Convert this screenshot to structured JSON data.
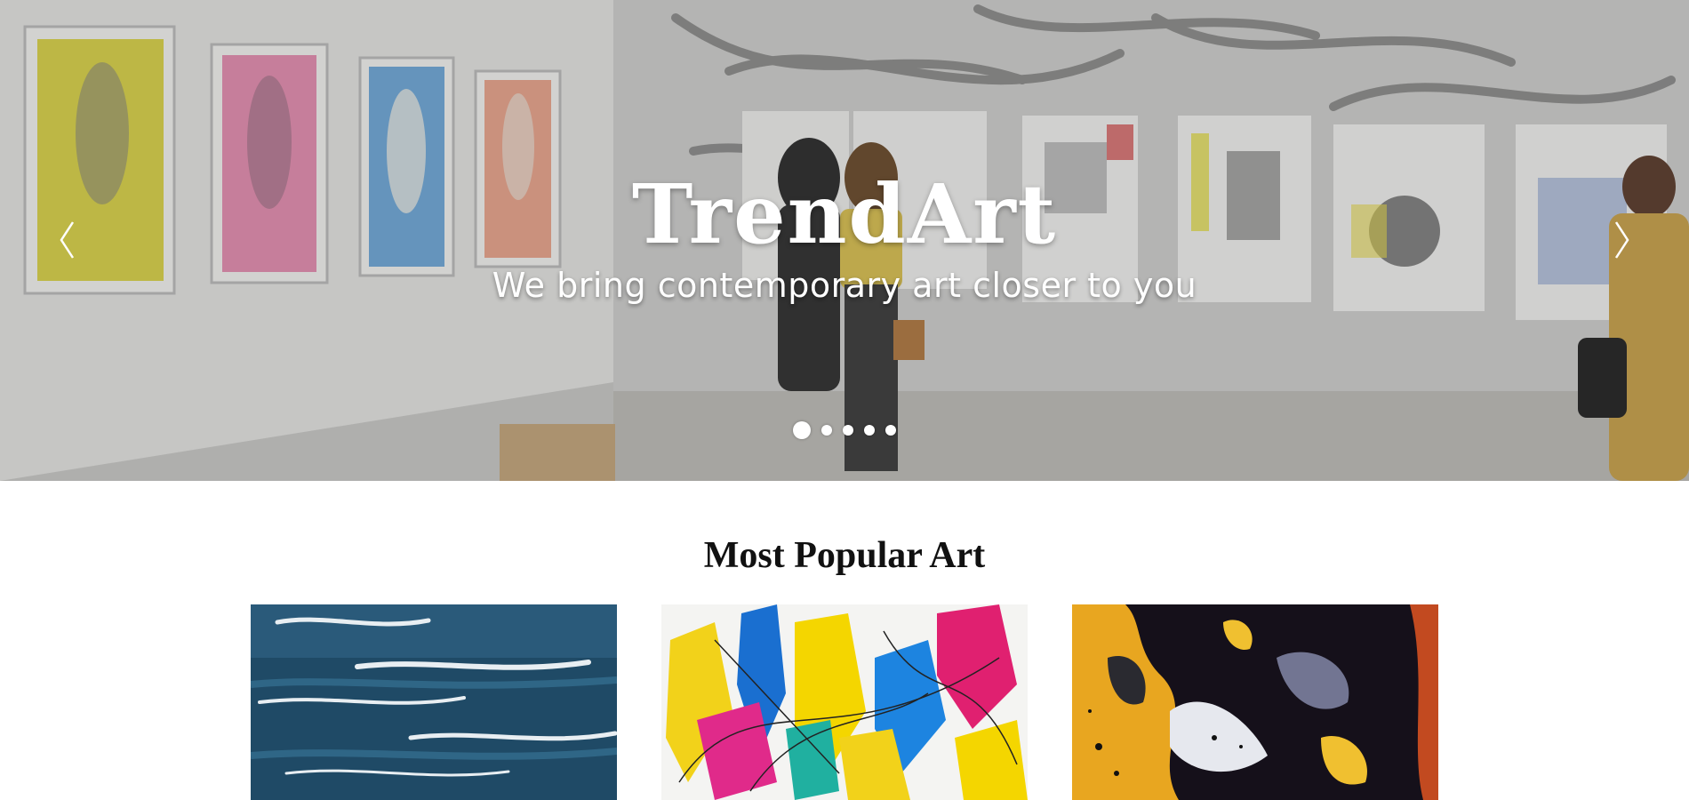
{
  "hero": {
    "title": "TrendArt",
    "subtitle": "We bring contemporary art closer to you",
    "slides_count": 5,
    "active_slide": 1,
    "prev_icon": "chevron-left-icon",
    "next_icon": "chevron-right-icon"
  },
  "popular": {
    "heading": "Most Popular Art",
    "items": [
      {
        "name": "blue-ocean-waves-painting"
      },
      {
        "name": "colorful-abstract-splash-painting"
      },
      {
        "name": "yellow-black-fluid-art-painting"
      }
    ]
  },
  "colors": {
    "text_white": "#ffffff",
    "heading_dark": "#111111",
    "background": "#ffffff"
  }
}
